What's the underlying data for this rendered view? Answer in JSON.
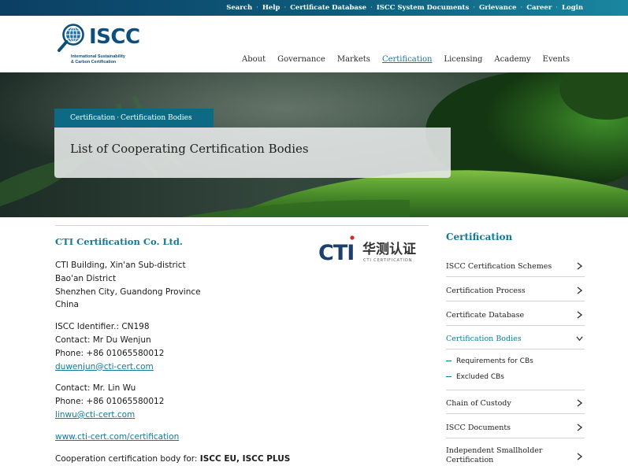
{
  "topnav": {
    "items": [
      "Search",
      "Help",
      "Certificate Database",
      "ISCC System Documents",
      "Grievance",
      "Career",
      "Login"
    ],
    "separator": "·"
  },
  "logo": {
    "name": "ISCC",
    "tagline_1": "International Sustainability",
    "tagline_2": "& Carbon Certification",
    "icon": "globe-magnifier-icon"
  },
  "mainnav": {
    "items": [
      "About",
      "Governance",
      "Markets",
      "Certification",
      "Licensing",
      "Academy",
      "Events"
    ],
    "active": "Certification"
  },
  "breadcrumb": {
    "items": [
      "Certification",
      "Certification Bodies"
    ],
    "separator": "·"
  },
  "page": {
    "title": "List of Cooperating Certification Bodies"
  },
  "body": {
    "name": "CTI Certification Co. Ltd.",
    "logo": {
      "latin": "CTI",
      "chinese": "华测认证",
      "small": "CTI CERTIFICATION"
    },
    "address": [
      "CTI Building, Xin'an Sub-district",
      "Bao'an District",
      "Shenzhen City, Guandong Province",
      "China"
    ],
    "identifier": "ISCC Identifier.: CN198",
    "contact1": {
      "name": "Contact: Mr Du Wenjun",
      "phone": "Phone: +86 01065580012",
      "email": "duwenjun@cti-cert.com"
    },
    "contact2": {
      "name": "Contact: Mr. Lin Wu",
      "phone": "Phone: +86 01065580012",
      "email": "linwu@cti-cert.com"
    },
    "website": "www.cti-cert.com/certification",
    "coop_prefix": "Cooperation certification body for: ",
    "coop_value": "ISCC EU, ISCC PLUS"
  },
  "sidebar": {
    "title": "Certification",
    "items": [
      "ISCC Certification Schemes",
      "Certification Process",
      "Certificate Database",
      "Certification Bodies",
      "Chain of Custody",
      "ISCC Documents",
      "Independent Smallholder Certification"
    ],
    "active": "Certification Bodies",
    "subitems": [
      "Requirements for CBs",
      "Excluded CBs"
    ]
  },
  "colors": {
    "accent": "#137a94",
    "brand_dark": "#0d4f7c",
    "topbar": "#0e5c7c",
    "cti_red": "#d9262a"
  }
}
